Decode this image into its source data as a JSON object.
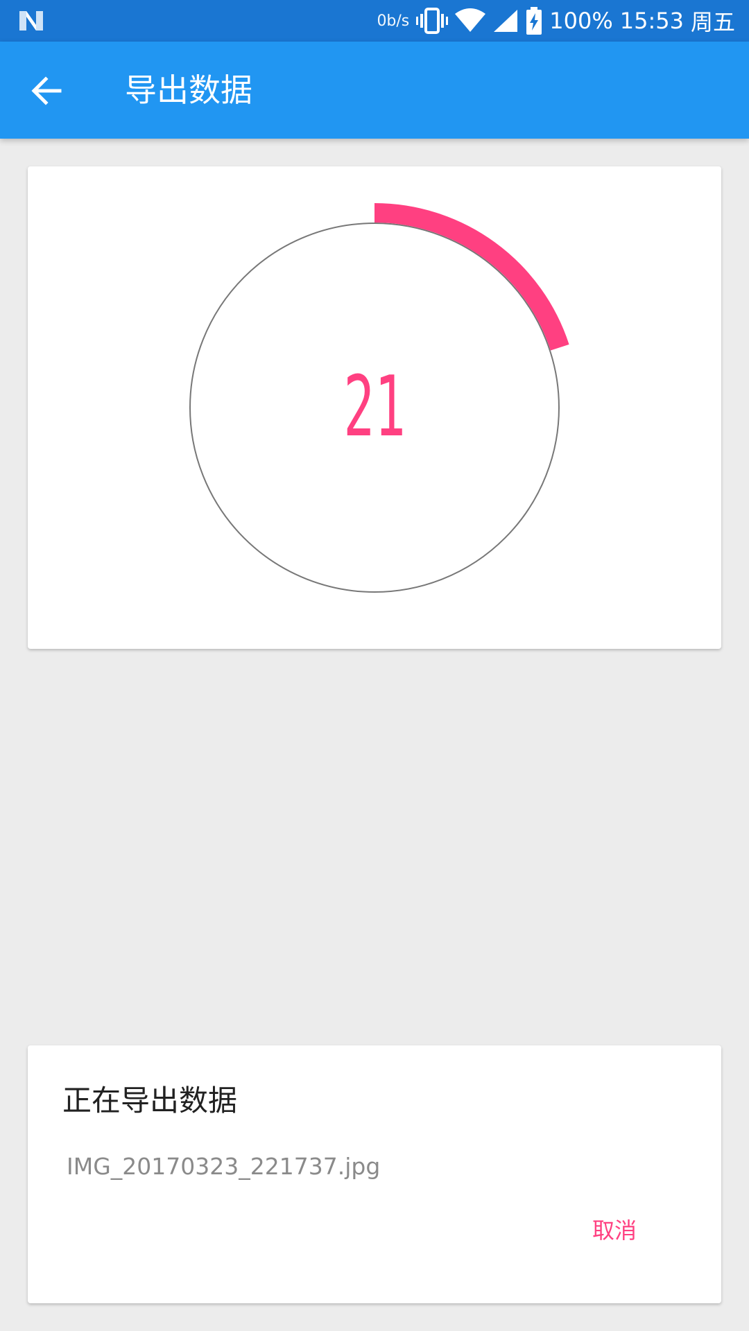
{
  "status_bar": {
    "net_speed": "0b/s",
    "battery_percent": "100%",
    "time": "15:53",
    "day": "周五",
    "icons": [
      "android-n-icon",
      "vibrate-icon",
      "wifi-icon",
      "signal-icon",
      "battery-charging-icon"
    ]
  },
  "app_bar": {
    "title": "导出数据",
    "back_icon": "arrow-back-icon",
    "color": "#2196f2"
  },
  "progress": {
    "count": "21",
    "fraction": 0.2,
    "arc_color": "#ff4081",
    "track_color": "#777777"
  },
  "dialog": {
    "title": "正在导出数据",
    "filename": "IMG_20170323_221737.jpg",
    "cancel_label": "取消"
  }
}
